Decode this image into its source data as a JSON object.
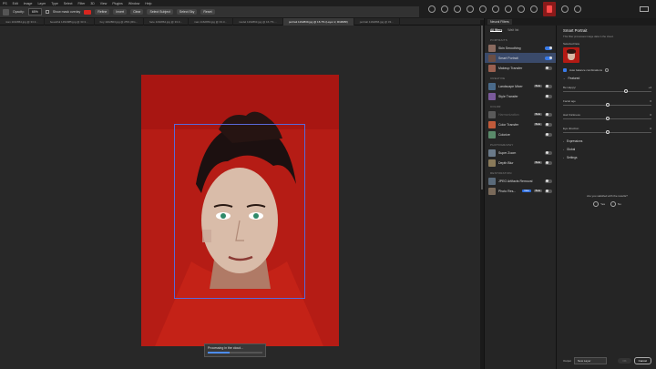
{
  "menu": [
    "PS",
    "Edit",
    "Image",
    "Layer",
    "Type",
    "Select",
    "Filter",
    "3D",
    "View",
    "Plugins",
    "Window",
    "Help"
  ],
  "options_bar": {
    "opacity_label": "Opacity:",
    "opacity_value": "65%",
    "show_mask_label": "Show mask overlay",
    "refine_label": "Refine",
    "invert_label": "Invert",
    "clear_label": "Clear",
    "select_subject_label": "Select Subject",
    "select_sky_label": "Select Sky",
    "reset_label": "Reset"
  },
  "doc_tabs": [
    {
      "label": "nian 1162864.jpg @ 33.3...",
      "active": false
    },
    {
      "label": "beautiful 1452985.jpg @ 33.3...",
      "active": false
    },
    {
      "label": "boy 1162863.jpg @ 25% (RG...",
      "active": false
    },
    {
      "label": "face 1162864.jpg @ 33.3...",
      "active": false
    },
    {
      "label": "man 1162863.jpg @ 33.3...",
      "active": false
    },
    {
      "label": "model 1162863.jpg @ 16.7% ...",
      "active": false
    },
    {
      "label": "portrait 1162839.jpg @ 16.7% (Layer 2, RGB/8#)",
      "active": true
    },
    {
      "label": "portrait 1162866.jpg @ 33...",
      "active": false
    }
  ],
  "progress": {
    "text": "Processing in the cloud...",
    "fraction": 0.4
  },
  "panel": {
    "tab_label": "Neural Filters",
    "filter_tabs": [
      "All filters",
      "Wait list"
    ],
    "categories": [
      {
        "name": "PORTRAITS",
        "items": [
          {
            "label": "Skin Smoothing",
            "badge": "",
            "toggle": "on",
            "dim": false,
            "selected": false,
            "thumb": "#8a6a5f"
          },
          {
            "label": "Smart Portrait",
            "badge": "",
            "toggle": "on",
            "dim": false,
            "selected": true,
            "thumb": "#6a4e45"
          },
          {
            "label": "Makeup Transfer",
            "badge": "",
            "toggle": "off",
            "dim": false,
            "selected": false,
            "thumb": "#9a6050"
          }
        ]
      },
      {
        "name": "CREATIVE",
        "items": [
          {
            "label": "Landscape Mixer",
            "badge": "Beta",
            "toggle": "off",
            "dim": false,
            "selected": false,
            "thumb": "#4a6a8a"
          },
          {
            "label": "Style Transfer",
            "badge": "",
            "toggle": "off",
            "dim": false,
            "selected": false,
            "thumb": "#7a5a9a"
          }
        ]
      },
      {
        "name": "COLOR",
        "items": [
          {
            "label": "Harmonization",
            "badge": "Beta",
            "toggle": "off",
            "dim": true,
            "selected": false,
            "thumb": "#5a5a5a"
          },
          {
            "label": "Color Transfer",
            "badge": "Beta",
            "toggle": "off",
            "dim": false,
            "selected": false,
            "thumb": "#c05a3a"
          },
          {
            "label": "Colorize",
            "badge": "",
            "toggle": "off",
            "dim": false,
            "selected": false,
            "thumb": "#5a8a6a"
          }
        ]
      },
      {
        "name": "PHOTOGRAPHY",
        "items": [
          {
            "label": "Super Zoom",
            "badge": "",
            "toggle": "off",
            "dim": false,
            "selected": false,
            "thumb": "#6a7a8a"
          },
          {
            "label": "Depth Blur",
            "badge": "Beta",
            "toggle": "off",
            "dim": false,
            "selected": false,
            "thumb": "#8a7a5a"
          }
        ]
      },
      {
        "name": "RESTORATION",
        "items": [
          {
            "label": "JPEG Artifacts Removal",
            "badge": "",
            "toggle": "off",
            "dim": false,
            "selected": false,
            "thumb": "#5a6a7a"
          },
          {
            "label": "Photo Res...",
            "badge": "New",
            "badge2": "Beta",
            "toggle": "off",
            "dim": false,
            "selected": false,
            "thumb": "#7a6a5a"
          }
        ]
      }
    ],
    "detail": {
      "title": "Smart Portrait",
      "description": "This filter processes image data in the cloud.",
      "selected_face_label": "Selected face",
      "auto_balance_label": "Auto balance combinations",
      "featured_label": "Featured",
      "sliders": [
        {
          "name": "Be Happy!",
          "value": "+4",
          "fraction": 0.71
        },
        {
          "name": "Facial age",
          "value": "0",
          "fraction": 0.5
        },
        {
          "name": "Hair thickness",
          "value": "0",
          "fraction": 0.5
        },
        {
          "name": "Eye direction",
          "value": "0",
          "fraction": 0.5
        }
      ],
      "sections": [
        "Expressions",
        "Global",
        "Settings"
      ],
      "question": "Are you satisfied with the results?",
      "yes": "Yes",
      "no": "No"
    },
    "footer": {
      "output_label": "Output",
      "output_value": "New Layer",
      "ok_label": "OK",
      "cancel_label": "Cancel"
    }
  }
}
